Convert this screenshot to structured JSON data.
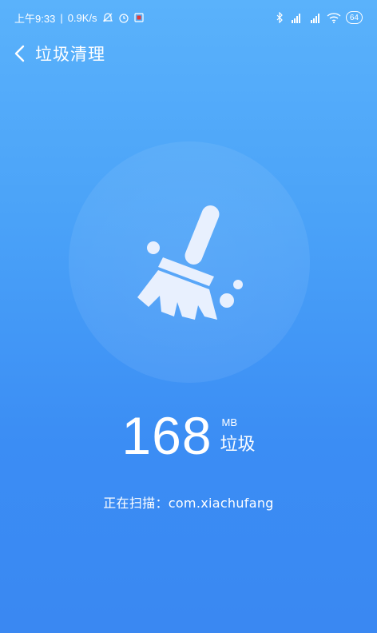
{
  "status_bar": {
    "time": "上午9:33",
    "speed": "0.9K/s",
    "battery": "64",
    "icons": [
      "mute-icon",
      "alarm-icon",
      "notification-icon",
      "bluetooth-icon",
      "signal-hd-icon",
      "signal-hd-icon",
      "wifi-icon",
      "battery-icon"
    ]
  },
  "app_bar": {
    "title": "垃圾清理",
    "back_icon": "chevron-left-icon"
  },
  "cleaner": {
    "icon": "broom-icon",
    "size_value": "168",
    "size_unit": "MB",
    "size_label": "垃圾",
    "scan_text": "正在扫描：com.xiachufang"
  },
  "colors": {
    "background_top": "#5ab2fb",
    "background_bottom": "#3a88f2",
    "broom": "#e8f0fe"
  }
}
